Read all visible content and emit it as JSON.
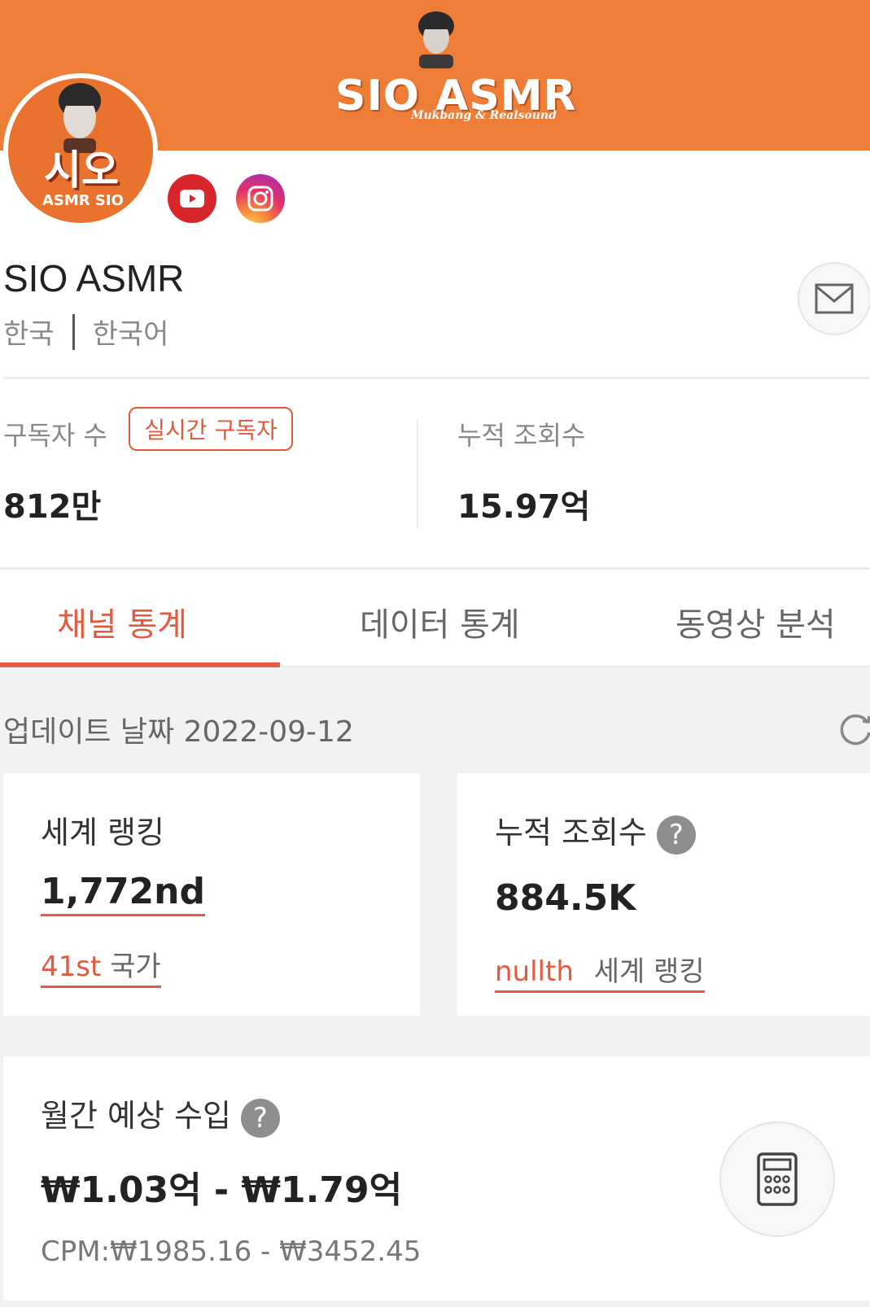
{
  "banner": {
    "title": "SIO ASMR",
    "subtitle": "Mukbang & Realsound",
    "color": "#ee7d38"
  },
  "avatar": {
    "brand": "시오",
    "brand_sub": "ASMR SIO"
  },
  "social": [
    "youtube-icon",
    "instagram-icon"
  ],
  "channel": {
    "name": "SIO ASMR",
    "country": "한국",
    "language": "한국어"
  },
  "stats": {
    "subscribers_label": "구독자 수",
    "realtime_badge": "실시간 구독자",
    "subscribers_value": "812만",
    "views_label": "누적 조회수",
    "views_value": "15.97억"
  },
  "tabs": [
    {
      "label": "채널 통계",
      "active": true
    },
    {
      "label": "데이터 통계",
      "active": false
    },
    {
      "label": "동영상 분석",
      "active": false
    }
  ],
  "update": {
    "label": "업데이트 날짜 2022-09-12"
  },
  "cards": {
    "world_rank_title": "세계 랭킹",
    "world_rank_value": "1,772nd",
    "country_rank": "41st",
    "country_label": "국가",
    "views_title": "누적 조회수",
    "views_value": "884.5K",
    "views_rank": "nullth",
    "views_rank_label": "세계 랭킹",
    "income_title": "월간 예상 수입",
    "income_value": "₩1.03억 - ₩1.79억",
    "cpm": "CPM:₩1985.16 - ₩3452.45",
    "question": "?"
  },
  "colors": {
    "accent": "#e35a3e",
    "background_gray": "#f1f2f4"
  }
}
